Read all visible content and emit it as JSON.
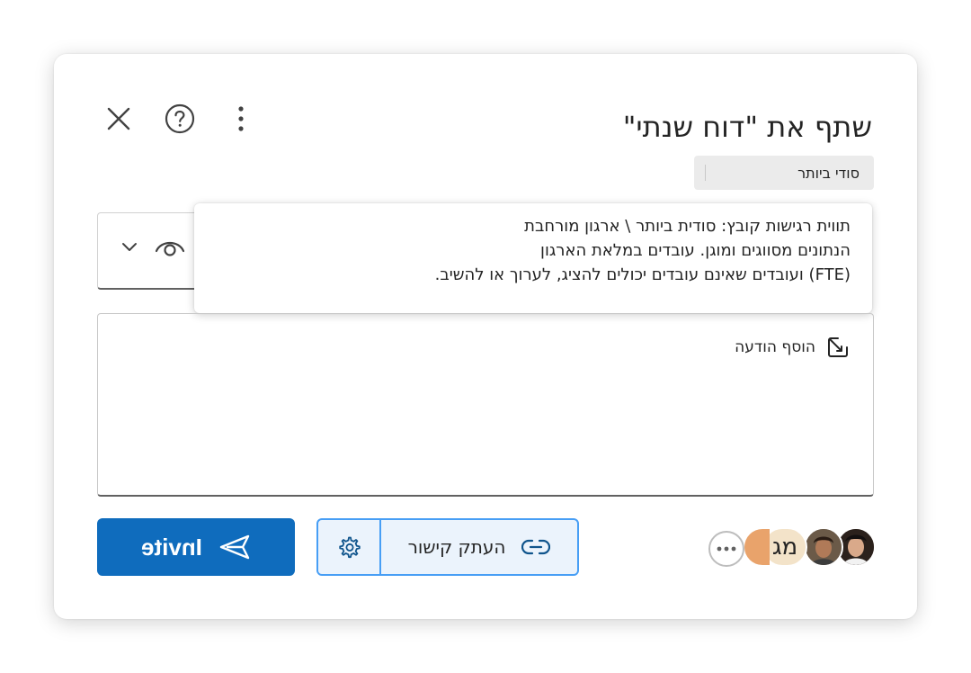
{
  "dialog": {
    "title": "שתף את \"דוח שנתי\"",
    "header_icons": [
      "close-icon",
      "help-icon",
      "more-vertical-icon"
    ]
  },
  "sensitivity": {
    "label": "סודי ביותר"
  },
  "tooltip": {
    "lines": [
      "תווית רגישות קובץ: סודית ביותר \\ ארגון מורחבת",
      "הנתונים מסווגים ומוגן. עובדים במלאת הארגון",
      "(FTE) ועובדים שאינם עובדים יכולים להציג, לערוך או להשיב."
    ]
  },
  "permission": {
    "icons": [
      "eye-icon",
      "chevron-down-icon"
    ]
  },
  "message": {
    "label": "הוסף הודעה",
    "icon": "edit-message-icon"
  },
  "actions": {
    "invite_label": "Invite",
    "copy_link_label": "העתק קישור",
    "settings_icon": "gear-icon",
    "link_icon": "link-icon",
    "send_icon": "send-icon"
  },
  "people": {
    "initials": "מג",
    "more_icon": "more-horizontal-icon"
  },
  "colors": {
    "accent": "#0f6cbd",
    "accent_border": "#479ef5",
    "badge_bg": "#ebebeb",
    "initials_bg": "#f3e3c9"
  }
}
